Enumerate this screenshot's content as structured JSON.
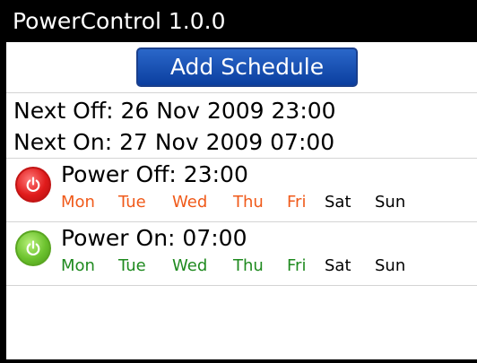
{
  "app": {
    "title": "PowerControl 1.0.0"
  },
  "toolbar": {
    "add_schedule_label": "Add Schedule"
  },
  "summary": {
    "next_off": "Next Off: 26 Nov 2009 23:00",
    "next_on": "Next On: 27 Nov 2009 07:00"
  },
  "schedules": [
    {
      "title": "Power Off: 23:00",
      "icon": "power-off-icon",
      "days": [
        "Mon",
        "Tue",
        "Wed",
        "Thu",
        "Fri",
        "Sat",
        "Sun"
      ],
      "active": [
        true,
        true,
        true,
        true,
        true,
        false,
        false
      ],
      "active_color": "#f05a1a"
    },
    {
      "title": "Power On: 07:00",
      "icon": "power-on-icon",
      "days": [
        "Mon",
        "Tue",
        "Wed",
        "Thu",
        "Fri",
        "Sat",
        "Sun"
      ],
      "active": [
        true,
        true,
        true,
        true,
        true,
        false,
        false
      ],
      "active_color": "#1f8a1f"
    }
  ]
}
